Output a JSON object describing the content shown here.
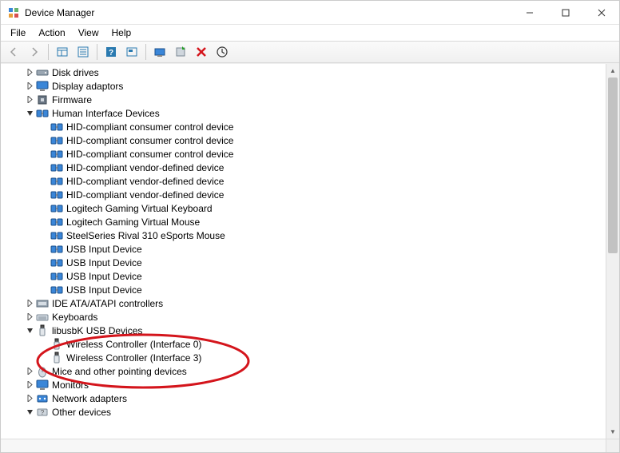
{
  "window": {
    "title": "Device Manager"
  },
  "menu": {
    "file": "File",
    "action": "Action",
    "view": "View",
    "help": "Help"
  },
  "tree": [
    {
      "level": 1,
      "expand": "closed",
      "icon": "drive",
      "label": "Disk drives"
    },
    {
      "level": 1,
      "expand": "closed",
      "icon": "monitor",
      "label": "Display adaptors"
    },
    {
      "level": 1,
      "expand": "closed",
      "icon": "chip",
      "label": "Firmware"
    },
    {
      "level": 1,
      "expand": "open",
      "icon": "hid",
      "label": "Human Interface Devices"
    },
    {
      "level": 2,
      "expand": "none",
      "icon": "hid",
      "label": "HID-compliant consumer control device"
    },
    {
      "level": 2,
      "expand": "none",
      "icon": "hid",
      "label": "HID-compliant consumer control device"
    },
    {
      "level": 2,
      "expand": "none",
      "icon": "hid",
      "label": "HID-compliant consumer control device"
    },
    {
      "level": 2,
      "expand": "none",
      "icon": "hid",
      "label": "HID-compliant vendor-defined device"
    },
    {
      "level": 2,
      "expand": "none",
      "icon": "hid",
      "label": "HID-compliant vendor-defined device"
    },
    {
      "level": 2,
      "expand": "none",
      "icon": "hid",
      "label": "HID-compliant vendor-defined device"
    },
    {
      "level": 2,
      "expand": "none",
      "icon": "hid",
      "label": "Logitech Gaming Virtual Keyboard"
    },
    {
      "level": 2,
      "expand": "none",
      "icon": "hid",
      "label": "Logitech Gaming Virtual Mouse"
    },
    {
      "level": 2,
      "expand": "none",
      "icon": "hid",
      "label": "SteelSeries Rival 310 eSports Mouse"
    },
    {
      "level": 2,
      "expand": "none",
      "icon": "hid",
      "label": "USB Input Device"
    },
    {
      "level": 2,
      "expand": "none",
      "icon": "hid",
      "label": "USB Input Device"
    },
    {
      "level": 2,
      "expand": "none",
      "icon": "hid",
      "label": "USB Input Device"
    },
    {
      "level": 2,
      "expand": "none",
      "icon": "hid",
      "label": "USB Input Device"
    },
    {
      "level": 1,
      "expand": "closed",
      "icon": "ide",
      "label": "IDE ATA/ATAPI controllers"
    },
    {
      "level": 1,
      "expand": "closed",
      "icon": "keyboard",
      "label": "Keyboards"
    },
    {
      "level": 1,
      "expand": "open",
      "icon": "usb",
      "label": "libusbK USB Devices"
    },
    {
      "level": 2,
      "expand": "none",
      "icon": "usb",
      "label": "Wireless Controller (Interface 0)"
    },
    {
      "level": 2,
      "expand": "none",
      "icon": "usb",
      "label": "Wireless Controller (Interface 3)"
    },
    {
      "level": 1,
      "expand": "closed",
      "icon": "mouse",
      "label": "Mice and other pointing devices"
    },
    {
      "level": 1,
      "expand": "closed",
      "icon": "monitor",
      "label": "Monitors"
    },
    {
      "level": 1,
      "expand": "closed",
      "icon": "network",
      "label": "Network adapters"
    },
    {
      "level": 1,
      "expand": "open",
      "icon": "other",
      "label": "Other devices"
    }
  ],
  "annotation": {
    "color": "#d4151c"
  }
}
